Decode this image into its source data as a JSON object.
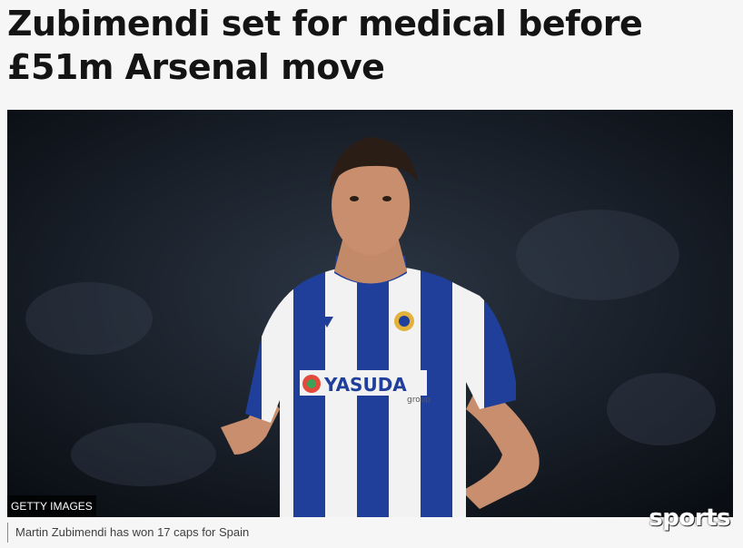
{
  "article": {
    "headline": "Zubimendi set for medical before £51m Arsenal move",
    "image_credit": "GETTY IMAGES",
    "caption": "Martin Zubimendi has won 17 caps for Spain",
    "sponsor_text": "YASUDA",
    "sponsor_subtext": "group",
    "watermark": "sports"
  },
  "colors": {
    "kit_blue": "#1f3f9a",
    "kit_white": "#f2f2f2",
    "headline": "#141414",
    "background": "#f6f6f6"
  }
}
